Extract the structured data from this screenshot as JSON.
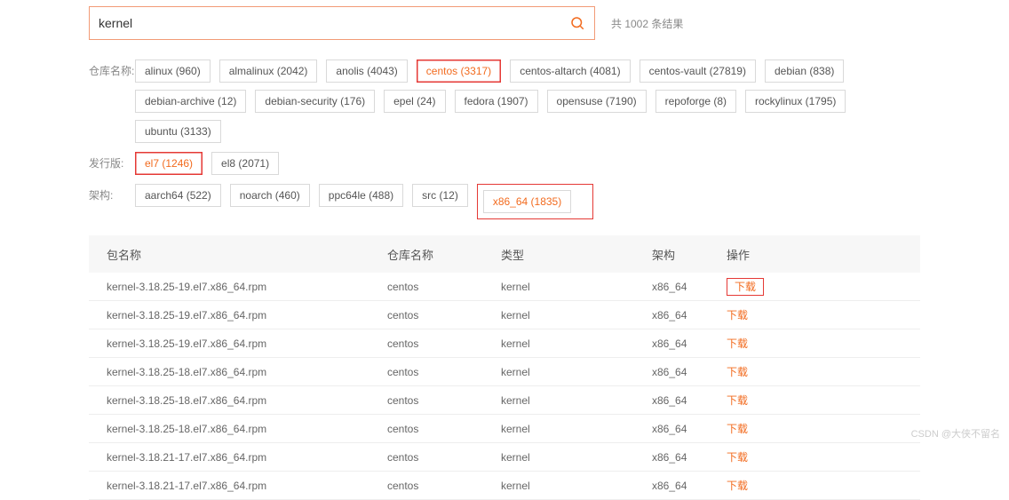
{
  "search": {
    "value": "kernel"
  },
  "result_count": "共 1002 条结果",
  "filters": {
    "repo_label": "仓库名称:",
    "dist_label": "发行版:",
    "arch_label": "架构:",
    "repos": [
      {
        "label": "alinux (960)",
        "active": false,
        "hl": false
      },
      {
        "label": "almalinux (2042)",
        "active": false,
        "hl": false
      },
      {
        "label": "anolis (4043)",
        "active": false,
        "hl": false
      },
      {
        "label": "centos (3317)",
        "active": true,
        "hl": true
      },
      {
        "label": "centos-altarch (4081)",
        "active": false,
        "hl": false
      },
      {
        "label": "centos-vault (27819)",
        "active": false,
        "hl": false
      },
      {
        "label": "debian (838)",
        "active": false,
        "hl": false
      },
      {
        "label": "debian-archive (12)",
        "active": false,
        "hl": false
      },
      {
        "label": "debian-security (176)",
        "active": false,
        "hl": false
      },
      {
        "label": "epel (24)",
        "active": false,
        "hl": false
      },
      {
        "label": "fedora (1907)",
        "active": false,
        "hl": false
      },
      {
        "label": "opensuse (7190)",
        "active": false,
        "hl": false
      },
      {
        "label": "repoforge (8)",
        "active": false,
        "hl": false
      },
      {
        "label": "rockylinux (1795)",
        "active": false,
        "hl": false
      },
      {
        "label": "ubuntu (3133)",
        "active": false,
        "hl": false
      }
    ],
    "dists": [
      {
        "label": "el7 (1246)",
        "active": true,
        "hl": true
      },
      {
        "label": "el8 (2071)",
        "active": false,
        "hl": false
      }
    ],
    "archs": [
      {
        "label": "aarch64 (522)",
        "active": false,
        "hl": false
      },
      {
        "label": "noarch (460)",
        "active": false,
        "hl": false
      },
      {
        "label": "ppc64le (488)",
        "active": false,
        "hl": false
      },
      {
        "label": "src (12)",
        "active": false,
        "hl": false
      },
      {
        "label": "x86_64 (1835)",
        "active": true,
        "hl": true
      }
    ]
  },
  "table": {
    "headers": {
      "pkg": "包名称",
      "repo": "仓库名称",
      "type": "类型",
      "arch": "架构",
      "act": "操作"
    },
    "download_label": "下载",
    "rows": [
      {
        "pkg": "kernel-3.18.25-19.el7.x86_64.rpm",
        "repo": "centos",
        "type": "kernel",
        "arch": "x86_64",
        "hl": true
      },
      {
        "pkg": "kernel-3.18.25-19.el7.x86_64.rpm",
        "repo": "centos",
        "type": "kernel",
        "arch": "x86_64",
        "hl": false
      },
      {
        "pkg": "kernel-3.18.25-19.el7.x86_64.rpm",
        "repo": "centos",
        "type": "kernel",
        "arch": "x86_64",
        "hl": false
      },
      {
        "pkg": "kernel-3.18.25-18.el7.x86_64.rpm",
        "repo": "centos",
        "type": "kernel",
        "arch": "x86_64",
        "hl": false
      },
      {
        "pkg": "kernel-3.18.25-18.el7.x86_64.rpm",
        "repo": "centos",
        "type": "kernel",
        "arch": "x86_64",
        "hl": false
      },
      {
        "pkg": "kernel-3.18.25-18.el7.x86_64.rpm",
        "repo": "centos",
        "type": "kernel",
        "arch": "x86_64",
        "hl": false
      },
      {
        "pkg": "kernel-3.18.21-17.el7.x86_64.rpm",
        "repo": "centos",
        "type": "kernel",
        "arch": "x86_64",
        "hl": false
      },
      {
        "pkg": "kernel-3.18.21-17.el7.x86_64.rpm",
        "repo": "centos",
        "type": "kernel",
        "arch": "x86_64",
        "hl": false
      }
    ]
  },
  "watermark": "CSDN @大侠不留名"
}
